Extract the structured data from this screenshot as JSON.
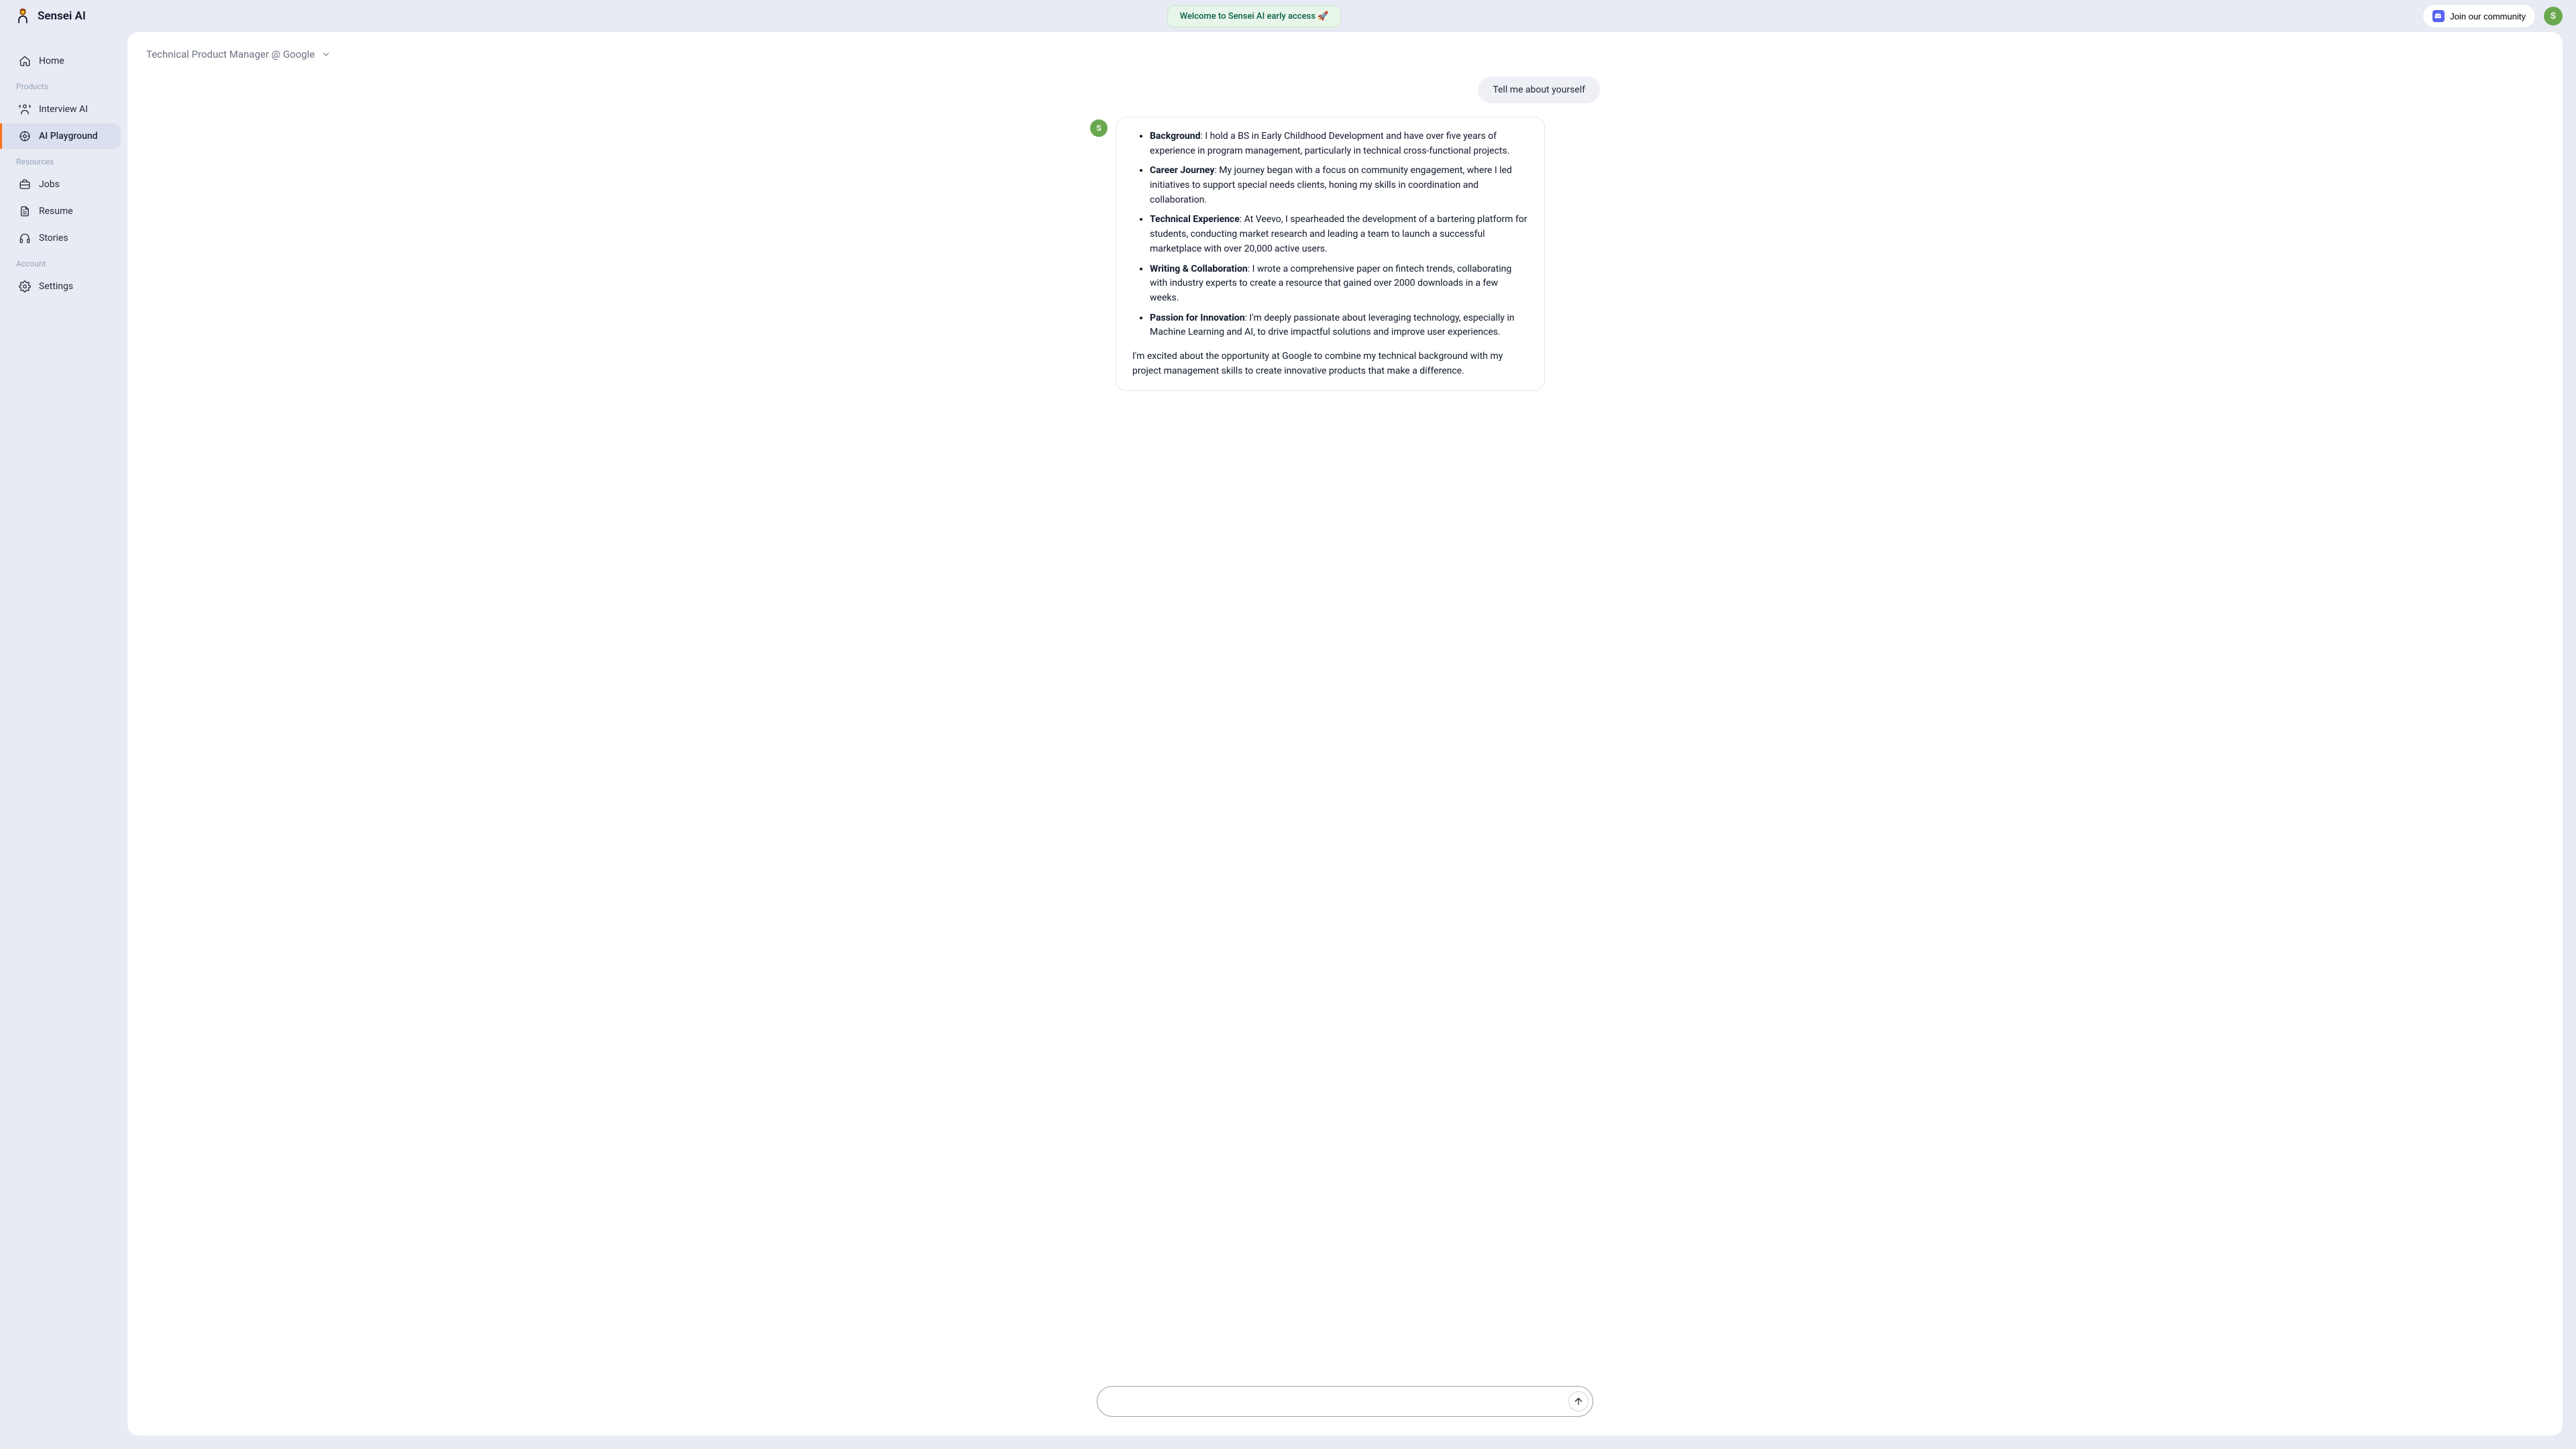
{
  "brand": {
    "name": "Sensei AI"
  },
  "header": {
    "welcome": "Welcome to Sensei AI early access 🚀",
    "community_label": "Join our community",
    "avatar_initial": "S"
  },
  "sidebar": {
    "sections": [
      {
        "label": "",
        "items": [
          {
            "id": "home",
            "label": "Home",
            "active": false
          }
        ]
      },
      {
        "label": "Products",
        "items": [
          {
            "id": "interview-ai",
            "label": "Interview AI",
            "active": false
          },
          {
            "id": "ai-playground",
            "label": "AI Playground",
            "active": true
          }
        ]
      },
      {
        "label": "Resources",
        "items": [
          {
            "id": "jobs",
            "label": "Jobs",
            "active": false
          },
          {
            "id": "resume",
            "label": "Resume",
            "active": false
          },
          {
            "id": "stories",
            "label": "Stories",
            "active": false
          }
        ]
      },
      {
        "label": "Account",
        "items": [
          {
            "id": "settings",
            "label": "Settings",
            "active": false
          }
        ]
      }
    ]
  },
  "context": {
    "title": "Technical Product Manager @ Google"
  },
  "conversation": {
    "user_message": "Tell me about yourself",
    "assistant_avatar_initial": "S",
    "bullets": [
      {
        "title": "Background",
        "text": ": I hold a BS in Early Childhood Development and have over five years of experience in program management, particularly in technical cross-functional projects."
      },
      {
        "title": "Career Journey",
        "text": ": My journey began with a focus on community engagement, where I led initiatives to support special needs clients, honing my skills in coordination and collaboration."
      },
      {
        "title": "Technical Experience",
        "text": ": At Veevo, I spearheaded the development of a bartering platform for students, conducting market research and leading a team to launch a successful marketplace with over 20,000 active users."
      },
      {
        "title": "Writing & Collaboration",
        "text": ": I wrote a comprehensive paper on fintech trends, collaborating with industry experts to create a resource that gained over 2000 downloads in a few weeks."
      },
      {
        "title": "Passion for Innovation",
        "text": ": I'm deeply passionate about leveraging technology, especially in Machine Learning and AI, to drive impactful solutions and improve user experiences."
      }
    ],
    "closing": "I'm excited about the opportunity at Google to combine my technical background with my project management skills to create innovative products that make a difference."
  },
  "input": {
    "placeholder": "",
    "value": ""
  }
}
